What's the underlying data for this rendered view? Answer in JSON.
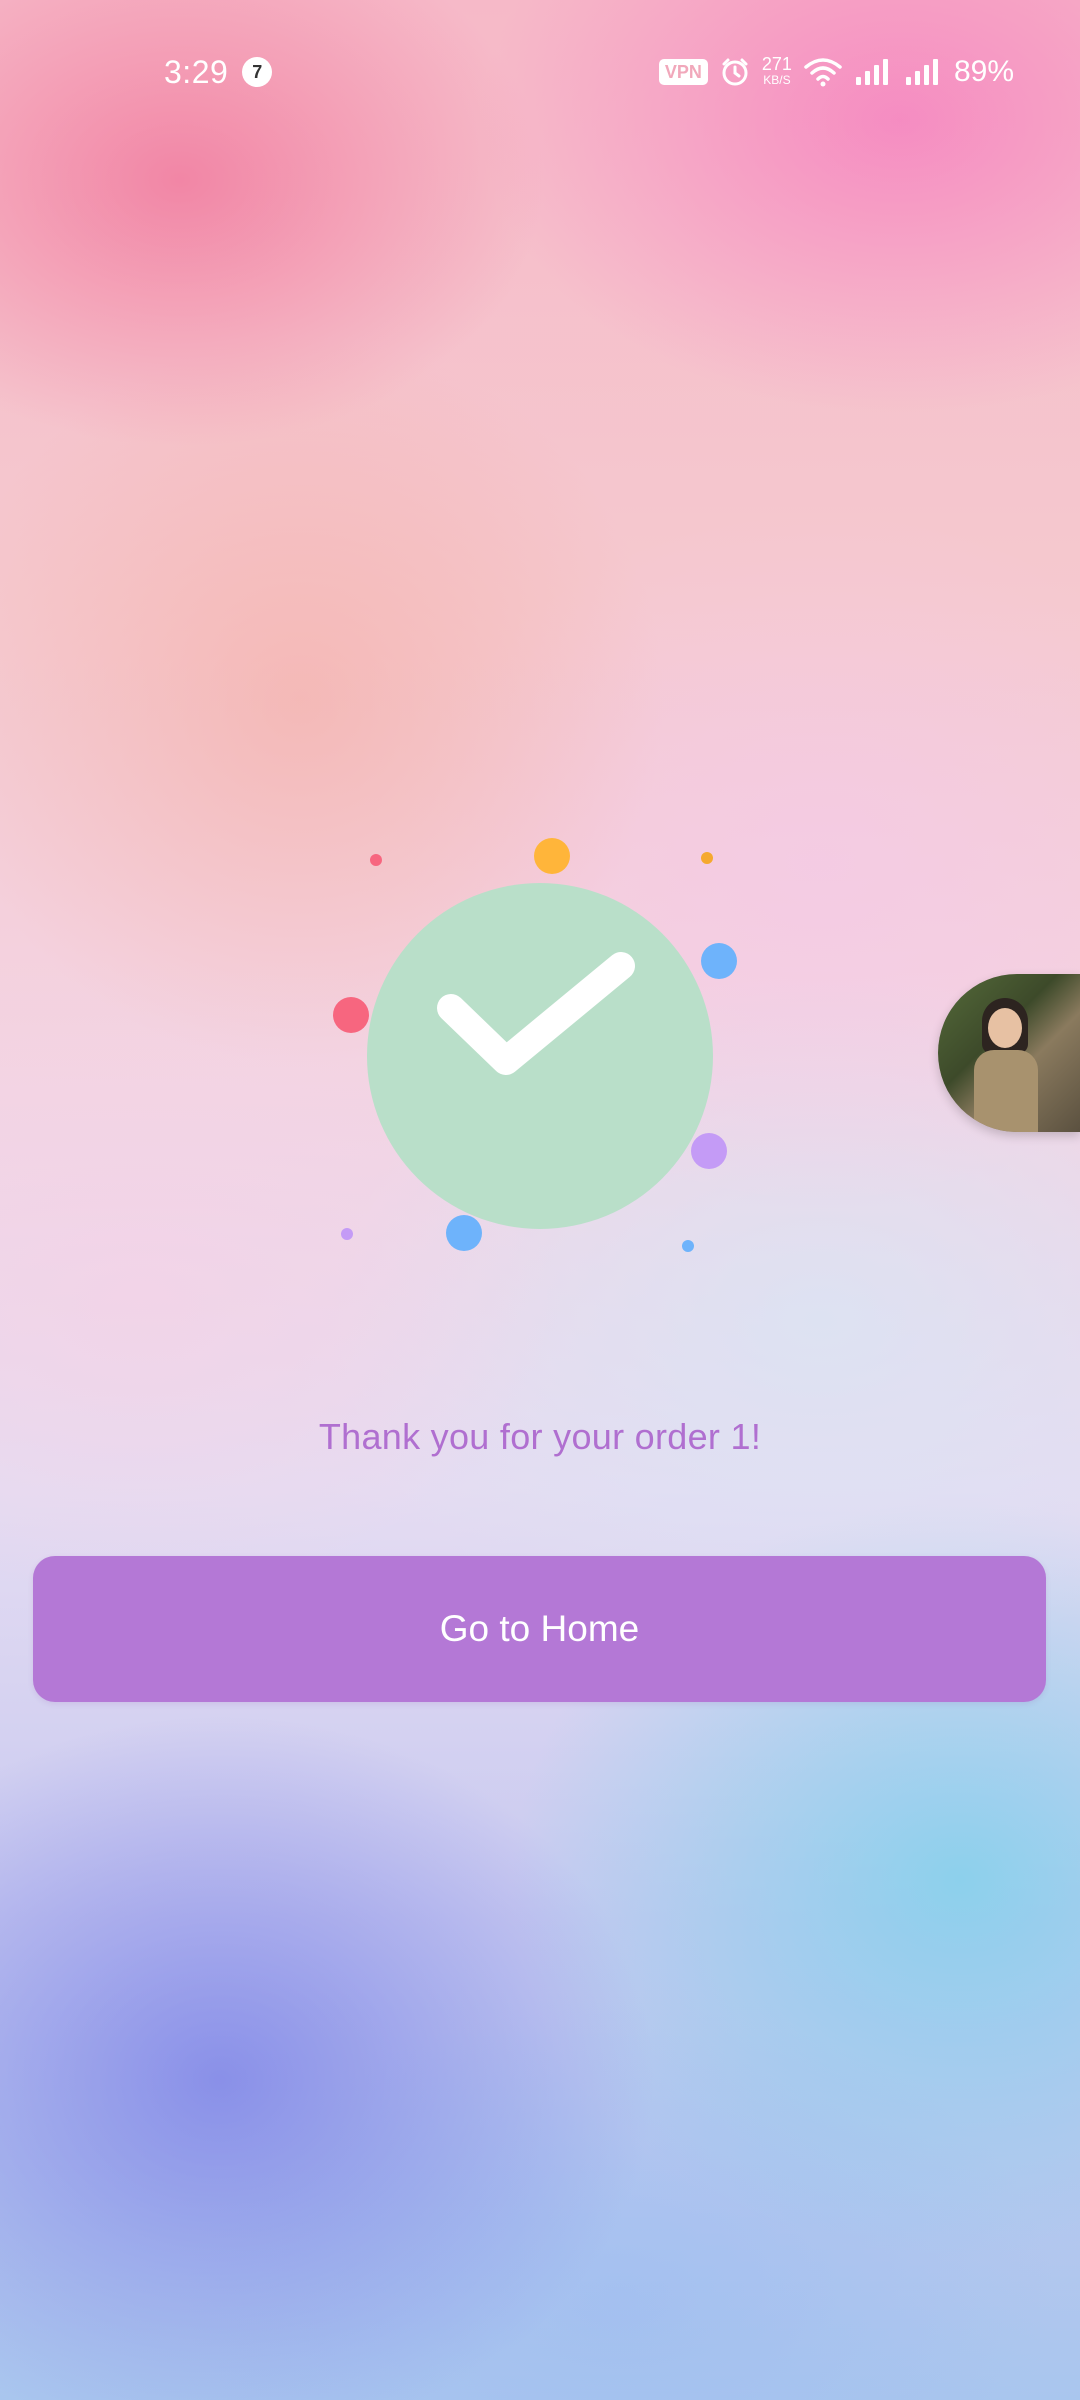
{
  "status_bar": {
    "time": "3:29",
    "notification_count": "7",
    "vpn_label": "VPN",
    "network_speed_value": "271",
    "network_speed_unit": "KB/S",
    "battery": "89%",
    "icons": [
      "alarm-icon",
      "wifi-icon",
      "signal-icon",
      "signal-icon"
    ]
  },
  "success": {
    "icon": "checkmark-icon",
    "circle_color": "#b9dfc9",
    "confetti_colors": [
      "#ffb53a",
      "#f7667f",
      "#6eb3fb",
      "#c49bf6"
    ]
  },
  "message": {
    "text": "Thank you for your order 1!",
    "color": "#b06fd0"
  },
  "home_button": {
    "label": "Go to Home",
    "color": "#b478d6"
  },
  "floating_avatar": {
    "icon": "avatar-photo"
  }
}
